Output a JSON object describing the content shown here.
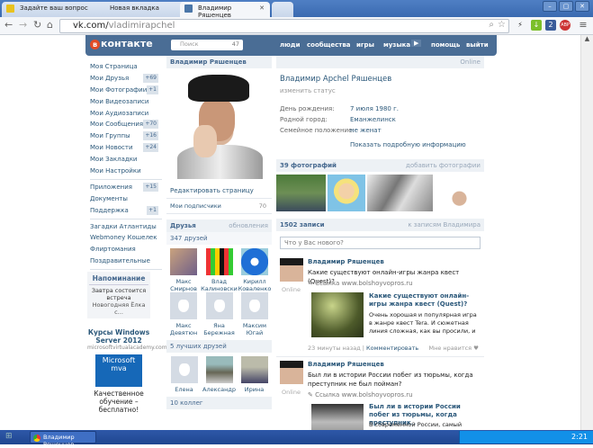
{
  "browser": {
    "tabs": [
      {
        "label": "Задайте ваш вопрос"
      },
      {
        "label": "Новая вкладка"
      },
      {
        "label": "Владимир Ряшенцев"
      }
    ],
    "url_host": "vk.com/",
    "url_path": "vladimirapchel",
    "ext_badge": "2",
    "abp": "ABP"
  },
  "vk": {
    "logo": "контакте",
    "search_placeholder": "Поиск",
    "search_count": "47",
    "nav": [
      "люди",
      "сообщества",
      "игры",
      "музыка",
      "помощь",
      "выйти"
    ],
    "menu": [
      {
        "label": "Моя Страница"
      },
      {
        "label": "Мои Друзья",
        "count": "+69"
      },
      {
        "label": "Мои Фотографии",
        "count": "+1"
      },
      {
        "label": "Мои Видеозаписи"
      },
      {
        "label": "Мои Аудиозаписи"
      },
      {
        "label": "Мои Сообщения",
        "count": "+70"
      },
      {
        "label": "Мои Группы",
        "count": "+16"
      },
      {
        "label": "Мои Новости",
        "count": "+24"
      },
      {
        "label": "Мои Закладки"
      },
      {
        "label": "Мои Настройки"
      }
    ],
    "menu2": [
      {
        "label": "Приложения",
        "count": "+15"
      },
      {
        "label": "Документы"
      },
      {
        "label": "Поддержка",
        "count": "+1"
      }
    ],
    "apps": [
      "Загадки Атлантиды",
      "Webmoney Кошелек",
      "Флиртомания",
      "Поздравительные"
    ],
    "reminder": {
      "title": "Напоминание",
      "line1": "Завтра состоится встреча",
      "line2": "Новогодняя Ёлка с..."
    },
    "ad": {
      "title": "Курсы Windows Server 2012",
      "url": "microsoftvirtualacademy.com",
      "logo": "Microsoft mva",
      "desc": "Качественное обучение – бесплатно!"
    },
    "profile": {
      "header": "Владимир Ряшенцев",
      "edit": "Редактировать страницу",
      "subs_label": "Мои подписчики",
      "subs_count": "70",
      "friends_title": "Друзья",
      "friends_updates": "обновления",
      "friends_count": "347 друзей",
      "friends": [
        "Макс Смирнов",
        "Влад Калиновски",
        "Кирилл Коваленко",
        "Макс Девятюн",
        "Яна Бережная",
        "Максим Югай"
      ],
      "best_title": "5 лучших друзей",
      "best": [
        "Елена",
        "Александр",
        "Ирина"
      ],
      "colleagues": "10 коллег"
    },
    "main": {
      "online": "Online",
      "name": "Владимир Apchel Ряшенцев",
      "status": "изменить статус",
      "info": [
        {
          "k": "День рождения:",
          "v": "7 июля 1980 г."
        },
        {
          "k": "Родной город:",
          "v": "Еманжелинск"
        },
        {
          "k": "Семейное положение:",
          "v": "не женат"
        }
      ],
      "more": "Показать подробную информацию",
      "photos_title": "39 фотографий",
      "photos_add": "добавить фотографии",
      "wall_title": "1502 записи",
      "wall_link": "к записям Владимира",
      "wall_placeholder": "Что у Вас нового?",
      "posts": [
        {
          "author": "Владимир Ряшенцев",
          "online": "Online",
          "text": "Какие существуют онлайн-игры жанра квест (Quest)?",
          "link": "Ссылка www.bolshoyvopros.ru",
          "ltitle": "Какие существуют онлайн-игры жанра квест (Quest)?",
          "ldesc": "Очень хорошая и популярная игра в жанре квест Tera. И сюжетная линия сложная, как вы просили, и",
          "time": "23 минуты назад",
          "comment": "Комментировать",
          "like": "Мне нравится"
        },
        {
          "author": "Владимир Ряшенцев",
          "online": "Online",
          "text": "Был ли в истории России побег из тюрьмы, когда преступник не был пойман?",
          "link": "Ссылка www.bolshoyvopros.ru",
          "ltitle": "Был ли в истории России побег из тюрьмы, когда преступник..",
          "ldesc": "В современной России, самый"
        }
      ]
    }
  },
  "taskbar": {
    "task": "Владимир Ряшенцев ...",
    "clock": "2:21"
  }
}
